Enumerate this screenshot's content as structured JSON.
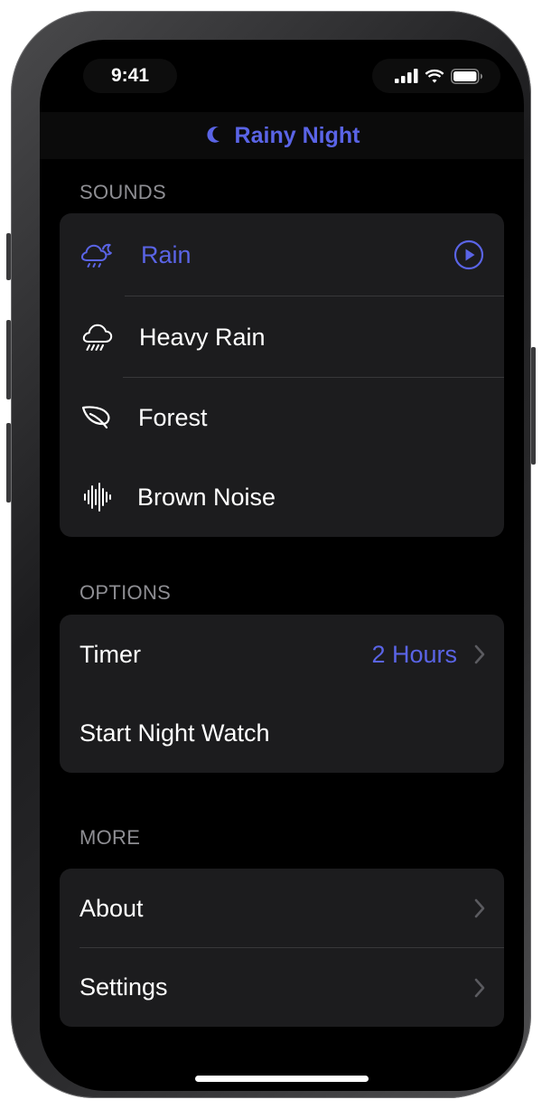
{
  "status_bar": {
    "time": "9:41",
    "icons": [
      "cellular-signal-icon",
      "wifi-icon",
      "battery-icon"
    ]
  },
  "nav": {
    "title": "Rainy Night",
    "icon": "moon-icon",
    "accent_color": "#5a64e6"
  },
  "sections": {
    "sounds": {
      "header": "SOUNDS",
      "items": [
        {
          "label": "Rain",
          "icon": "cloud-moon-rain-icon",
          "selected": true,
          "trailing_icon": "play-circle-icon"
        },
        {
          "label": "Heavy Rain",
          "icon": "cloud-heavy-rain-icon",
          "selected": false
        },
        {
          "label": "Forest",
          "icon": "leaf-icon",
          "selected": false
        },
        {
          "label": "Brown Noise",
          "icon": "waveform-icon",
          "selected": false
        }
      ]
    },
    "options": {
      "header": "OPTIONS",
      "timer": {
        "label": "Timer",
        "value": "2 Hours"
      },
      "night_watch": {
        "label": "Start Night Watch"
      }
    },
    "more": {
      "header": "MORE",
      "about": {
        "label": "About"
      },
      "settings": {
        "label": "Settings"
      }
    }
  }
}
